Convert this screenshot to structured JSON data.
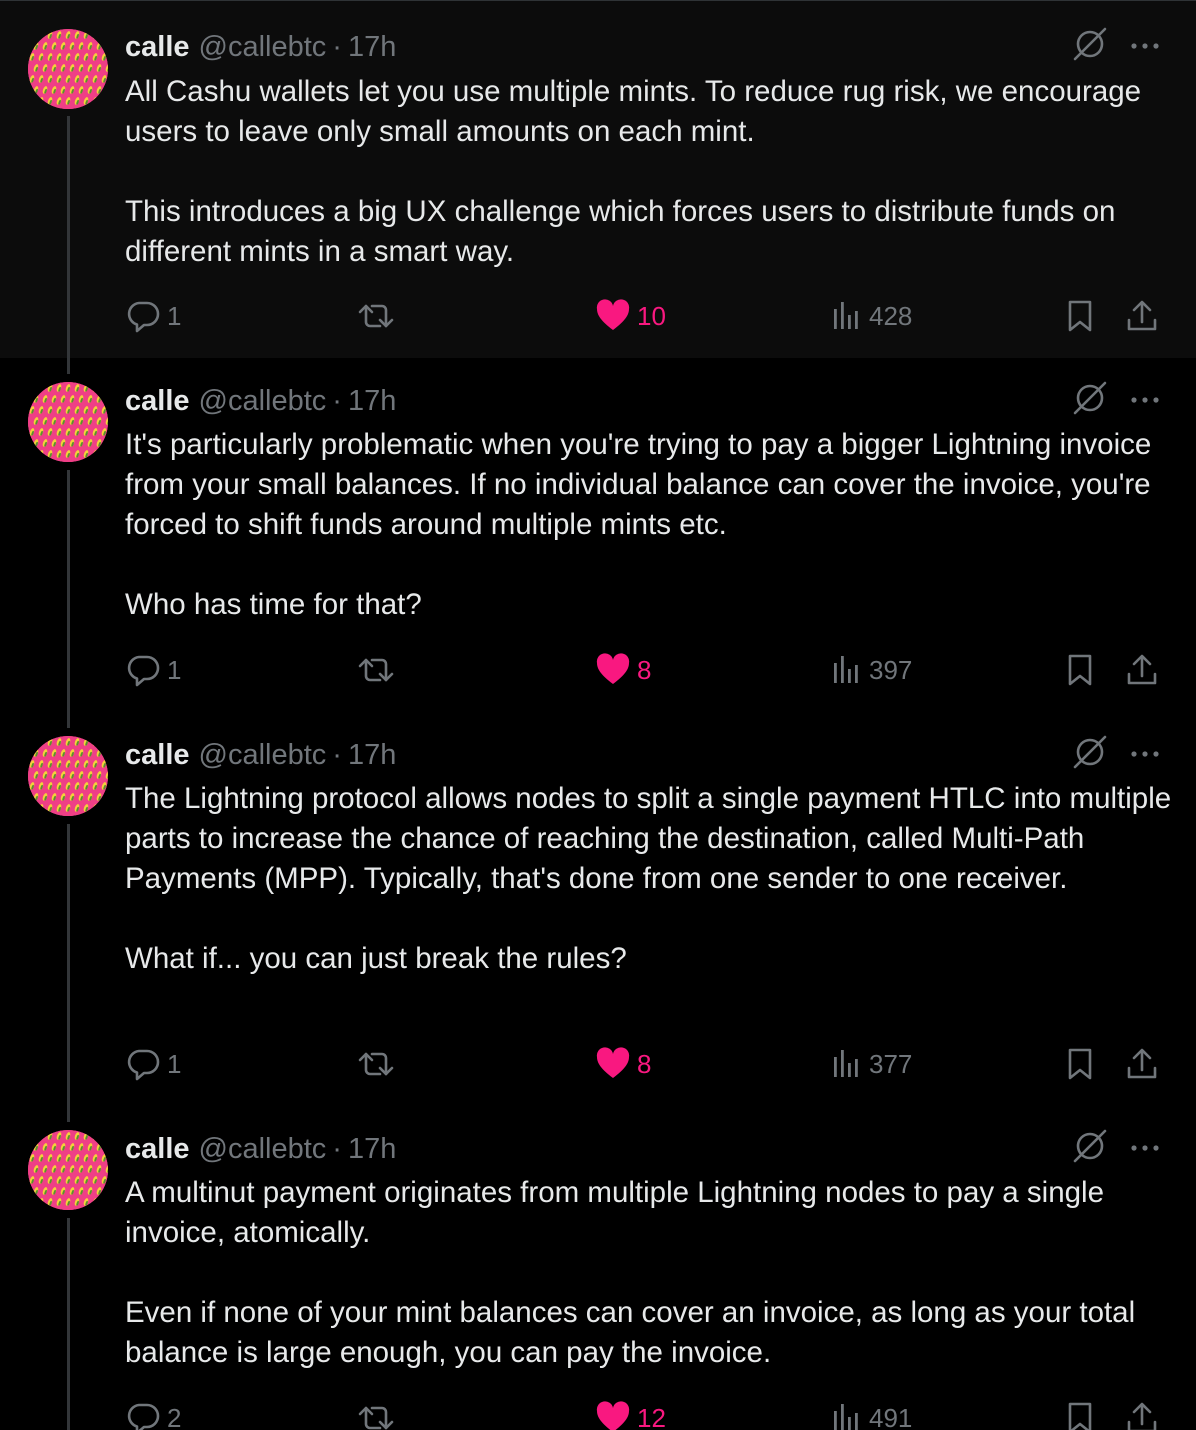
{
  "colors": {
    "background": "#000000",
    "highlight_background": "#0c0c0c",
    "text": "#e7e9ea",
    "muted": "#71767b",
    "like": "#f91880",
    "thread_line": "#333639",
    "avatar_pink": "#ef3f86"
  },
  "icons": {
    "grok": "grok-slash-icon",
    "more": "more-dots-icon",
    "reply": "reply-bubble-icon",
    "retweet": "retweet-icon",
    "like": "heart-icon",
    "views": "views-bars-icon",
    "bookmark": "bookmark-icon",
    "share": "share-upload-icon"
  },
  "tweets": [
    {
      "name": "calle",
      "handle": "@callebtc",
      "dot": "·",
      "time": "17h",
      "paragraphs": [
        "All Cashu wallets let you use multiple mints. To reduce rug risk, we encourage users to leave only small amounts on each mint.",
        "This introduces a big UX challenge which forces users to distribute funds on different mints in a smart way."
      ],
      "replies": "1",
      "likes": "10",
      "views": "428"
    },
    {
      "name": "calle",
      "handle": "@callebtc",
      "dot": "·",
      "time": "17h",
      "paragraphs": [
        "It's particularly problematic when you're trying to pay a bigger Lightning invoice from your small balances. If no individual balance can cover the invoice, you're forced to shift funds around multiple mints etc.",
        "Who has time for that?"
      ],
      "replies": "1",
      "likes": "8",
      "views": "397"
    },
    {
      "name": "calle",
      "handle": "@callebtc",
      "dot": "·",
      "time": "17h",
      "paragraphs": [
        "The Lightning protocol allows nodes to split a single payment HTLC into multiple parts to increase the chance of reaching the destination, called Multi-Path Payments (MPP). Typically, that's done from one sender to one receiver.",
        "What if... you can just break the rules?"
      ],
      "replies": "1",
      "likes": "8",
      "views": "377"
    },
    {
      "name": "calle",
      "handle": "@callebtc",
      "dot": "·",
      "time": "17h",
      "paragraphs": [
        "A multinut payment originates from multiple Lightning nodes to pay a single invoice, atomically.",
        "Even if none of your mint balances can cover an invoice, as long as your total balance is large enough, you can pay the invoice."
      ],
      "replies": "2",
      "likes": "12",
      "views": "491"
    }
  ]
}
